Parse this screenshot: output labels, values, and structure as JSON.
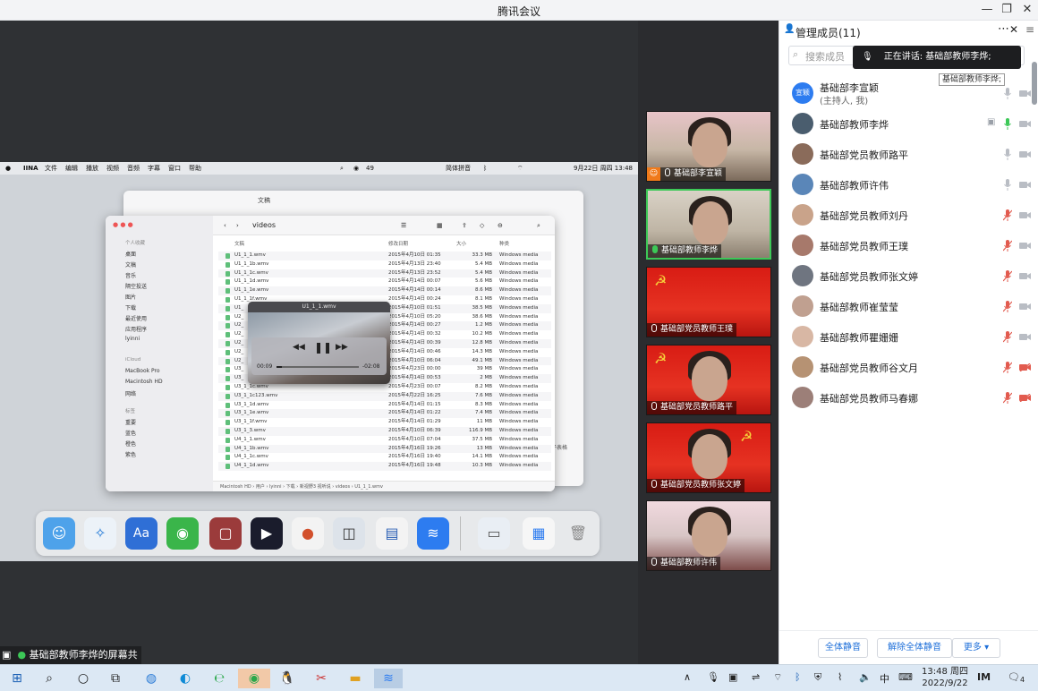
{
  "window": {
    "title": "腾讯会议"
  },
  "mac_menu": {
    "app": "IINA",
    "items": [
      "文件",
      "编辑",
      "播放",
      "视频",
      "音频",
      "字幕",
      "窗口",
      "帮助"
    ],
    "status_count": "49",
    "ime": "简体拼音",
    "datetime": "9月22日 周四 13:48"
  },
  "finder_back": {
    "title": "文稿"
  },
  "finder": {
    "title": "videos",
    "columns": {
      "name": "文稿",
      "date": "修改日期",
      "size": "大小",
      "kind": "种类"
    },
    "sidebar": {
      "fav_header": "个人收藏",
      "items": [
        "桌面",
        "文稿",
        "音乐",
        "隔空投送",
        "图片",
        "下载",
        "最近使用",
        "应用程序",
        "lyinni"
      ],
      "icloud": "iCloud",
      "locations": [
        "MacBook Pro",
        "Macintosh HD",
        "网络"
      ],
      "tags_header": "标签",
      "tags": [
        "重要",
        "蓝色",
        "橙色",
        "紫色"
      ]
    },
    "rows": [
      {
        "name": "U1_1_1.wmv",
        "date": "2015年4月10日 01:35",
        "size": "33.3 MB",
        "kind": "Windows media"
      },
      {
        "name": "U1_1_1b.wmv",
        "date": "2015年4月13日 23:40",
        "size": "5.4 MB",
        "kind": "Windows media"
      },
      {
        "name": "U1_1_1c.wmv",
        "date": "2015年4月13日 23:52",
        "size": "5.4 MB",
        "kind": "Windows media"
      },
      {
        "name": "U1_1_1d.wmv",
        "date": "2015年4月14日 00:07",
        "size": "5.6 MB",
        "kind": "Windows media"
      },
      {
        "name": "U1_1_1e.wmv",
        "date": "2015年4月14日 00:14",
        "size": "8.6 MB",
        "kind": "Windows media"
      },
      {
        "name": "U1_1_1f.wmv",
        "date": "2015年4月14日 00:24",
        "size": "8.1 MB",
        "kind": "Windows media"
      },
      {
        "name": "U1_",
        "date": "2015年4月10日 01:51",
        "size": "38.5 MB",
        "kind": "Windows media"
      },
      {
        "name": "U2_",
        "date": "2015年4月10日 05:20",
        "size": "38.6 MB",
        "kind": "Windows media"
      },
      {
        "name": "U2_",
        "date": "2015年4月14日 00:27",
        "size": "1.2 MB",
        "kind": "Windows media"
      },
      {
        "name": "U2_",
        "date": "2015年4月14日 00:32",
        "size": "10.2 MB",
        "kind": "Windows media"
      },
      {
        "name": "U2_",
        "date": "2015年4月14日 00:39",
        "size": "12.8 MB",
        "kind": "Windows media"
      },
      {
        "name": "U2_",
        "date": "2015年4月14日 00:46",
        "size": "14.3 MB",
        "kind": "Windows media"
      },
      {
        "name": "U2_",
        "date": "2015年4月10日 06:04",
        "size": "49.1 MB",
        "kind": "Windows media"
      },
      {
        "name": "U3_",
        "date": "2015年4月23日 00:00",
        "size": "39 MB",
        "kind": "Windows media"
      },
      {
        "name": "U3_",
        "date": "2015年4月14日 00:53",
        "size": "2 MB",
        "kind": "Windows media"
      },
      {
        "name": "U3_1_1c.wmv",
        "date": "2015年4月23日 00:07",
        "size": "8.2 MB",
        "kind": "Windows media"
      },
      {
        "name": "U3_1_1c123.wmv",
        "date": "2015年4月22日 16:25",
        "size": "7.6 MB",
        "kind": "Windows media"
      },
      {
        "name": "U3_1_1d.wmv",
        "date": "2015年4月14日 01:15",
        "size": "8.3 MB",
        "kind": "Windows media"
      },
      {
        "name": "U3_1_1e.wmv",
        "date": "2015年4月14日 01:22",
        "size": "7.4 MB",
        "kind": "Windows media"
      },
      {
        "name": "U3_1_1f.wmv",
        "date": "2015年4月14日 01:29",
        "size": "11 MB",
        "kind": "Windows media"
      },
      {
        "name": "U3_1_3.wmv",
        "date": "2015年4月10日 06:39",
        "size": "116.9 MB",
        "kind": "Windows media"
      },
      {
        "name": "U4_1_1.wmv",
        "date": "2015年4月10日 07:04",
        "size": "37.5 MB",
        "kind": "Windows media"
      },
      {
        "name": "U4_1_1b.wmv",
        "date": "2015年4月16日 19:26",
        "size": "13 MB",
        "kind": "Windows media"
      },
      {
        "name": "U4_1_1c.wmv",
        "date": "2015年4月16日 19:40",
        "size": "14.1 MB",
        "kind": "Windows media"
      },
      {
        "name": "U4_1_1d.wmv",
        "date": "2015年4月16日 19:48",
        "size": "10.3 MB",
        "kind": "Windows media"
      }
    ],
    "path": "Macintosh HD › 用户 › lyinni › 下载 › 新视野3 视听说 › videos › U1_1_1.wmv",
    "side_extra": "子表格"
  },
  "player": {
    "title": "U1_1_1.wmv",
    "elapsed": "00:09",
    "remaining": "-02:08",
    "progress": 0.07
  },
  "share_banner": "基础部教师李烨的屏幕共享",
  "tiles": [
    {
      "label": "基础部李宣颖"
    },
    {
      "label": "基础部教师李烨"
    },
    {
      "label": "基础部党员教师王璞"
    },
    {
      "label": "基础部党员教师路平"
    },
    {
      "label": "基础部党员教师张文婷"
    },
    {
      "label": "基础部教师许伟"
    }
  ],
  "panel": {
    "title": "管理成员(11)",
    "search_placeholder": "搜索成员",
    "speaking": "正在讲话: 基础部教师李烨;",
    "tooltip": "基础部教师李烨;",
    "members": [
      {
        "name": "基础部李宣颖",
        "sub": "(主持人, 我)",
        "avatar_text": "宣颖",
        "mic": "off",
        "cam": "off"
      },
      {
        "name": "基础部教师李烨",
        "sub": "",
        "avatar_text": "",
        "mic": "on",
        "cam": "off"
      },
      {
        "name": "基础部党员教师路平",
        "sub": "",
        "avatar_text": "",
        "mic": "off",
        "cam": "off"
      },
      {
        "name": "基础部教师许伟",
        "sub": "",
        "avatar_text": "",
        "mic": "off",
        "cam": "off"
      },
      {
        "name": "基础部党员教师刘丹",
        "sub": "",
        "avatar_text": "",
        "mic": "muted",
        "cam": "off"
      },
      {
        "name": "基础部党员教师王璞",
        "sub": "",
        "avatar_text": "",
        "mic": "muted",
        "cam": "off"
      },
      {
        "name": "基础部党员教师张文婷",
        "sub": "",
        "avatar_text": "",
        "mic": "muted",
        "cam": "off"
      },
      {
        "name": "基础部教师崔莹莹",
        "sub": "",
        "avatar_text": "",
        "mic": "muted",
        "cam": "off"
      },
      {
        "name": "基础部教师瞿姗姗",
        "sub": "",
        "avatar_text": "",
        "mic": "muted",
        "cam": "off"
      },
      {
        "name": "基础部党员教师谷文月",
        "sub": "",
        "avatar_text": "",
        "mic": "muted",
        "cam": "muted"
      },
      {
        "name": "基础部党员教师马春娜",
        "sub": "",
        "avatar_text": "",
        "mic": "muted",
        "cam": "muted"
      }
    ],
    "footer": {
      "mute_all": "全体静音",
      "unmute_all": "解除全体静音",
      "more": "更多 ▾"
    }
  },
  "taskbar": {
    "time": "13:48 周四",
    "date": "2022/9/22",
    "ime": "中",
    "notif": "4"
  }
}
